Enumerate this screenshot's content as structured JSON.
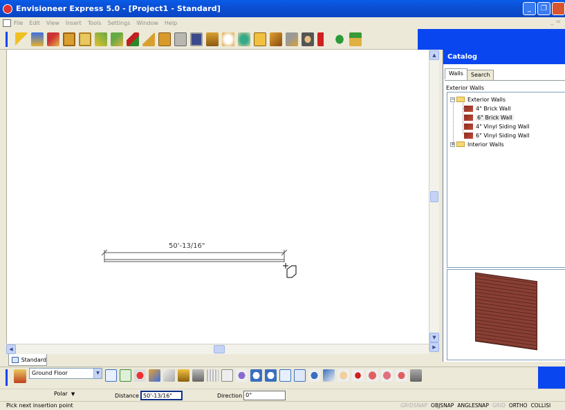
{
  "titlebar": {
    "title": "Envisioneer Express 5.0 - [Project1 - Standard]"
  },
  "menubar": {
    "items": [
      "File",
      "Edit",
      "View",
      "Insert",
      "Tools",
      "Settings",
      "Window",
      "Help"
    ],
    "right": "_ ="
  },
  "catalog": {
    "header": "Catalog",
    "tabs": [
      "Walls",
      "Search"
    ],
    "section_label": "Exterior Walls",
    "tree": {
      "root": "Exterior Walls",
      "items": [
        "4\" Brick Wall",
        "6\" Brick Wall",
        "4\" Vinyl Siding Wall",
        "6\" Vinyl Siding Wall"
      ],
      "selected": "6\" Brick Wall",
      "other": "Interior Walls"
    }
  },
  "canvas": {
    "dimension_label": "50'-13/16\""
  },
  "tabs": {
    "view_tab": "Standard"
  },
  "bottombar": {
    "floor_select": "Ground Floor"
  },
  "statusbar": {
    "polar_label": "Polar",
    "distance_label": "Distance",
    "distance_value": "50'-13/16\"",
    "direction_label": "Direction",
    "direction_value": "0°"
  },
  "hintbar": {
    "prompt": "Pick next insertion point",
    "snaps": [
      {
        "label": "GRIDSNAP",
        "on": false
      },
      {
        "label": "OBJSNAP",
        "on": true
      },
      {
        "label": "ANGLESNAP",
        "on": true
      },
      {
        "label": "GRID",
        "on": false
      },
      {
        "label": "ORTHO",
        "on": true
      },
      {
        "label": "COLLISI",
        "on": true
      }
    ]
  }
}
